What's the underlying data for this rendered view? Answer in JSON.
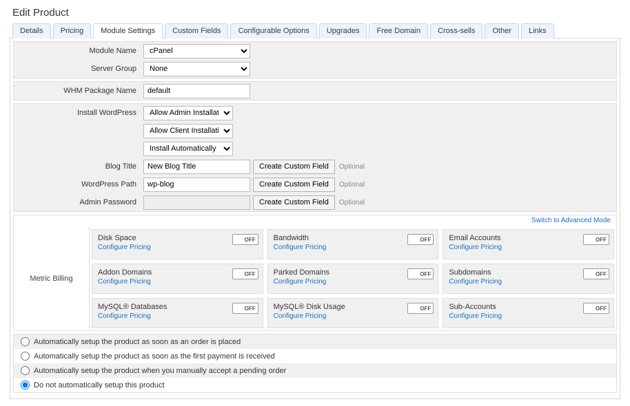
{
  "page_title": "Edit Product",
  "tabs": [
    "Details",
    "Pricing",
    "Module Settings",
    "Custom Fields",
    "Configurable Options",
    "Upgrades",
    "Free Domain",
    "Cross-sells",
    "Other",
    "Links"
  ],
  "active_tab_index": 2,
  "module": {
    "module_name_label": "Module Name",
    "module_name_value": "cPanel",
    "server_group_label": "Server Group",
    "server_group_value": "None"
  },
  "whm": {
    "label": "WHM Package Name",
    "value": "default"
  },
  "wp": {
    "install_label": "Install WordPress",
    "sel1": "Allow Admin Installation",
    "sel2": "Allow Client Installation",
    "sel3": "Install Automatically",
    "blog_title_label": "Blog Title",
    "blog_title_value": "New Blog Title",
    "path_label": "WordPress Path",
    "path_value": "wp-blog",
    "admin_pw_label": "Admin Password",
    "admin_pw_value": "",
    "create_btn": "Create Custom Field",
    "optional": "Optional"
  },
  "advanced_link": "Switch to Advanced Mode",
  "metric_billing": {
    "header": "Metric Billing",
    "configure": "Configure Pricing",
    "off": "OFF",
    "items": [
      "Disk Space",
      "Bandwidth",
      "Email Accounts",
      "Addon Domains",
      "Parked Domains",
      "Subdomains",
      "MySQL® Databases",
      "MySQL® Disk Usage",
      "Sub-Accounts"
    ]
  },
  "auto_setup": {
    "options": [
      "Automatically setup the product as soon as an order is placed",
      "Automatically setup the product as soon as the first payment is received",
      "Automatically setup the product when you manually accept a pending order",
      "Do not automatically setup this product"
    ],
    "selected_index": 3
  }
}
